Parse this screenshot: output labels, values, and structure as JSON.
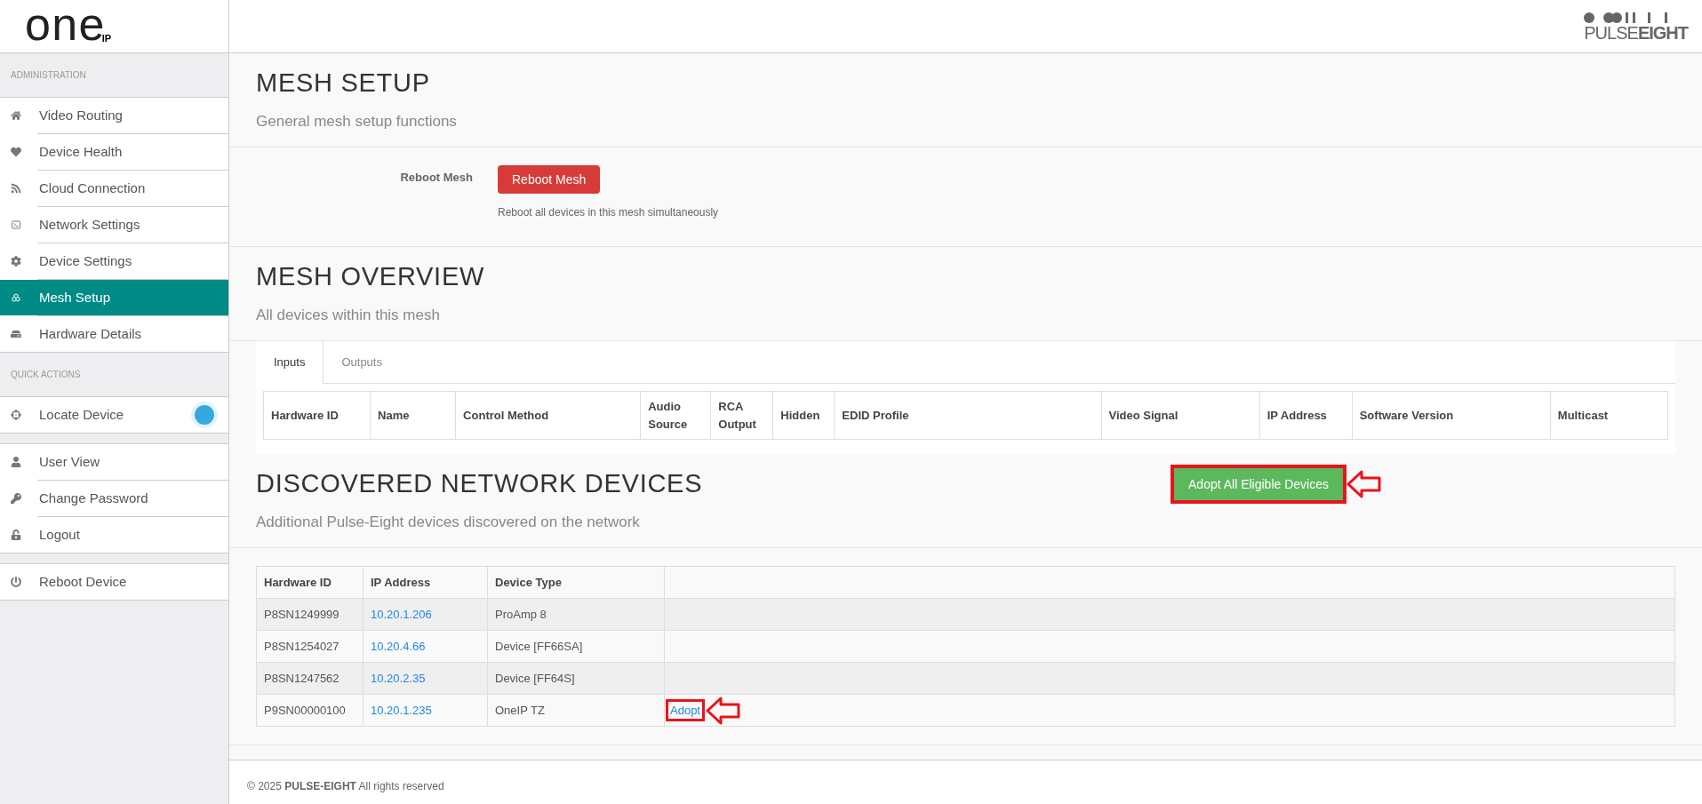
{
  "header": {
    "logo": {
      "word": "one",
      "sub": "IP"
    },
    "brand": {
      "left": "PULSE",
      "right": "EIGHT"
    }
  },
  "sidebar": {
    "groups": [
      {
        "heading": "ADMINISTRATION",
        "items": [
          {
            "label": "Video Routing",
            "kind": "link",
            "selected": false
          },
          {
            "label": "Device Health",
            "kind": "link",
            "selected": false
          },
          {
            "label": "Cloud Connection",
            "kind": "link",
            "selected": false
          },
          {
            "label": "Network Settings",
            "kind": "link",
            "selected": false
          },
          {
            "label": "Device Settings",
            "kind": "link",
            "selected": false
          },
          {
            "label": "Mesh Setup",
            "kind": "link",
            "selected": true
          },
          {
            "label": "Hardware Details",
            "kind": "link",
            "selected": false
          }
        ]
      },
      {
        "heading": "QUICK ACTIONS",
        "items": [
          {
            "label": "Locate Device",
            "kind": "toggle",
            "selected": false,
            "on": true
          }
        ]
      },
      {
        "items": [
          {
            "label": "User View",
            "kind": "link",
            "selected": false
          },
          {
            "label": "Change Password",
            "kind": "link",
            "selected": false
          },
          {
            "label": "Logout",
            "kind": "link",
            "selected": false
          }
        ]
      },
      {
        "items": [
          {
            "label": "Reboot Device",
            "kind": "link",
            "selected": false
          }
        ]
      }
    ]
  },
  "mesh_setup": {
    "title": "MESH SETUP",
    "subtitle": "General mesh setup functions",
    "field_label": "Reboot Mesh",
    "button": "Reboot Mesh",
    "help": "Reboot all devices in this mesh simultaneously"
  },
  "mesh_overview": {
    "title": "MESH OVERVIEW",
    "subtitle": "All devices within this mesh",
    "tabs": [
      {
        "label": "Inputs",
        "selected": true
      },
      {
        "label": "Outputs",
        "selected": false
      }
    ],
    "columns": [
      "Hardware ID",
      "Name",
      "Control Method",
      "Audio Source",
      "RCA Output",
      "Hidden",
      "EDID Profile",
      "Video Signal",
      "IP Address",
      "Software Version",
      "Multicast"
    ]
  },
  "discovered": {
    "title": "DISCOVERED NETWORK DEVICES",
    "subtitle": "Additional Pulse-Eight devices discovered on the network",
    "adopt_all": {
      "label": "Adopt All Eligible Devices",
      "highlighted": true
    },
    "columns": [
      "Hardware ID",
      "IP Address",
      "Device Type"
    ],
    "rows": [
      {
        "hardware_id": "P8SN1249999",
        "ip": "10.20.1.206",
        "type": "ProAmp 8"
      },
      {
        "hardware_id": "P8SN1254027",
        "ip": "10.20.4.66",
        "type": "Device [FF66SA]"
      },
      {
        "hardware_id": "P8SN1247562",
        "ip": "10.20.2.35",
        "type": "Device [FF64S]"
      },
      {
        "hardware_id": "P9SN00000100",
        "ip": "10.20.1.235",
        "type": "OneIP TZ",
        "action": {
          "label": "Adopt",
          "highlighted": true
        }
      }
    ]
  },
  "footer": {
    "year": "© 2025",
    "company": "PULSE-EIGHT",
    "rights": "All rights reserved"
  }
}
